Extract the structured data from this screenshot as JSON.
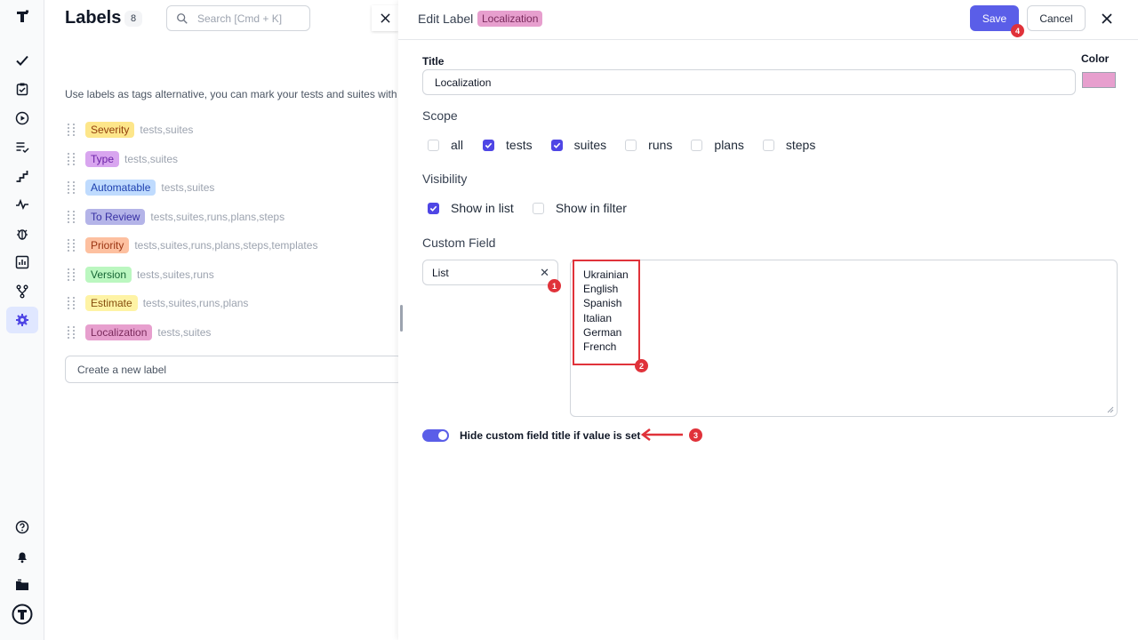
{
  "sidebar": {
    "icons": [
      "logo-icon",
      "check-icon",
      "clipboard-check-icon",
      "play-icon",
      "list-check-icon",
      "steps-icon",
      "pulse-icon",
      "bug-icon",
      "chart-icon",
      "branch-icon",
      "gear-icon",
      "help-icon",
      "bell-icon",
      "folder-icon",
      "user-logo-icon"
    ]
  },
  "labels_page": {
    "title": "Labels",
    "count": "8",
    "search_placeholder": "Search [Cmd + K]",
    "intro": "Use labels as tags alternative, you can mark your tests and suites with",
    "labels": [
      {
        "name": "Severity",
        "scope": "tests,suites",
        "bg": "#fde68a",
        "fg": "#92400e"
      },
      {
        "name": "Type",
        "scope": "tests,suites",
        "bg": "#d8a5ef",
        "fg": "#6b21a8"
      },
      {
        "name": "Automatable",
        "scope": "tests,suites",
        "bg": "#bfdbfe",
        "fg": "#1e40af"
      },
      {
        "name": "To Review",
        "scope": "tests,suites,runs,plans,steps",
        "bg": "#b4b4e8",
        "fg": "#3730a3"
      },
      {
        "name": "Priority",
        "scope": "tests,suites,runs,plans,steps,templates",
        "bg": "#fdc0a0",
        "fg": "#9a3412"
      },
      {
        "name": "Version",
        "scope": "tests,suites,runs",
        "bg": "#bbf7c0",
        "fg": "#166534"
      },
      {
        "name": "Estimate",
        "scope": "tests,suites,runs,plans",
        "bg": "#fef3a5",
        "fg": "#854d0e"
      },
      {
        "name": "Localization",
        "scope": "tests,suites",
        "bg": "#e79fce",
        "fg": "#7a2a5c"
      }
    ],
    "create_placeholder": "Create a new label"
  },
  "panel": {
    "heading": "Edit Label",
    "label_name": "Localization",
    "save_label": "Save",
    "cancel_label": "Cancel",
    "title_label": "Title",
    "title_value": "Localization",
    "color_label": "Color",
    "color_value": "#e79fce",
    "scope_label": "Scope",
    "scope_options": [
      {
        "label": "all",
        "checked": false
      },
      {
        "label": "tests",
        "checked": true
      },
      {
        "label": "suites",
        "checked": true
      },
      {
        "label": "runs",
        "checked": false
      },
      {
        "label": "plans",
        "checked": false
      },
      {
        "label": "steps",
        "checked": false
      }
    ],
    "visibility_label": "Visibility",
    "visibility_options": [
      {
        "label": "Show in list",
        "checked": true
      },
      {
        "label": "Show in filter",
        "checked": false
      }
    ],
    "custom_field_label": "Custom Field",
    "field_type": "List",
    "field_values": [
      "Ukrainian",
      "English",
      "Spanish",
      "Italian",
      "German",
      "French"
    ],
    "toggle_on": true,
    "toggle_label": "Hide custom field title if value is set"
  },
  "annotations": [
    "1",
    "2",
    "3",
    "4"
  ],
  "colors": {
    "accent": "#5a5ee8",
    "checkbox": "#4f46e5",
    "annotation": "#e0323a"
  }
}
